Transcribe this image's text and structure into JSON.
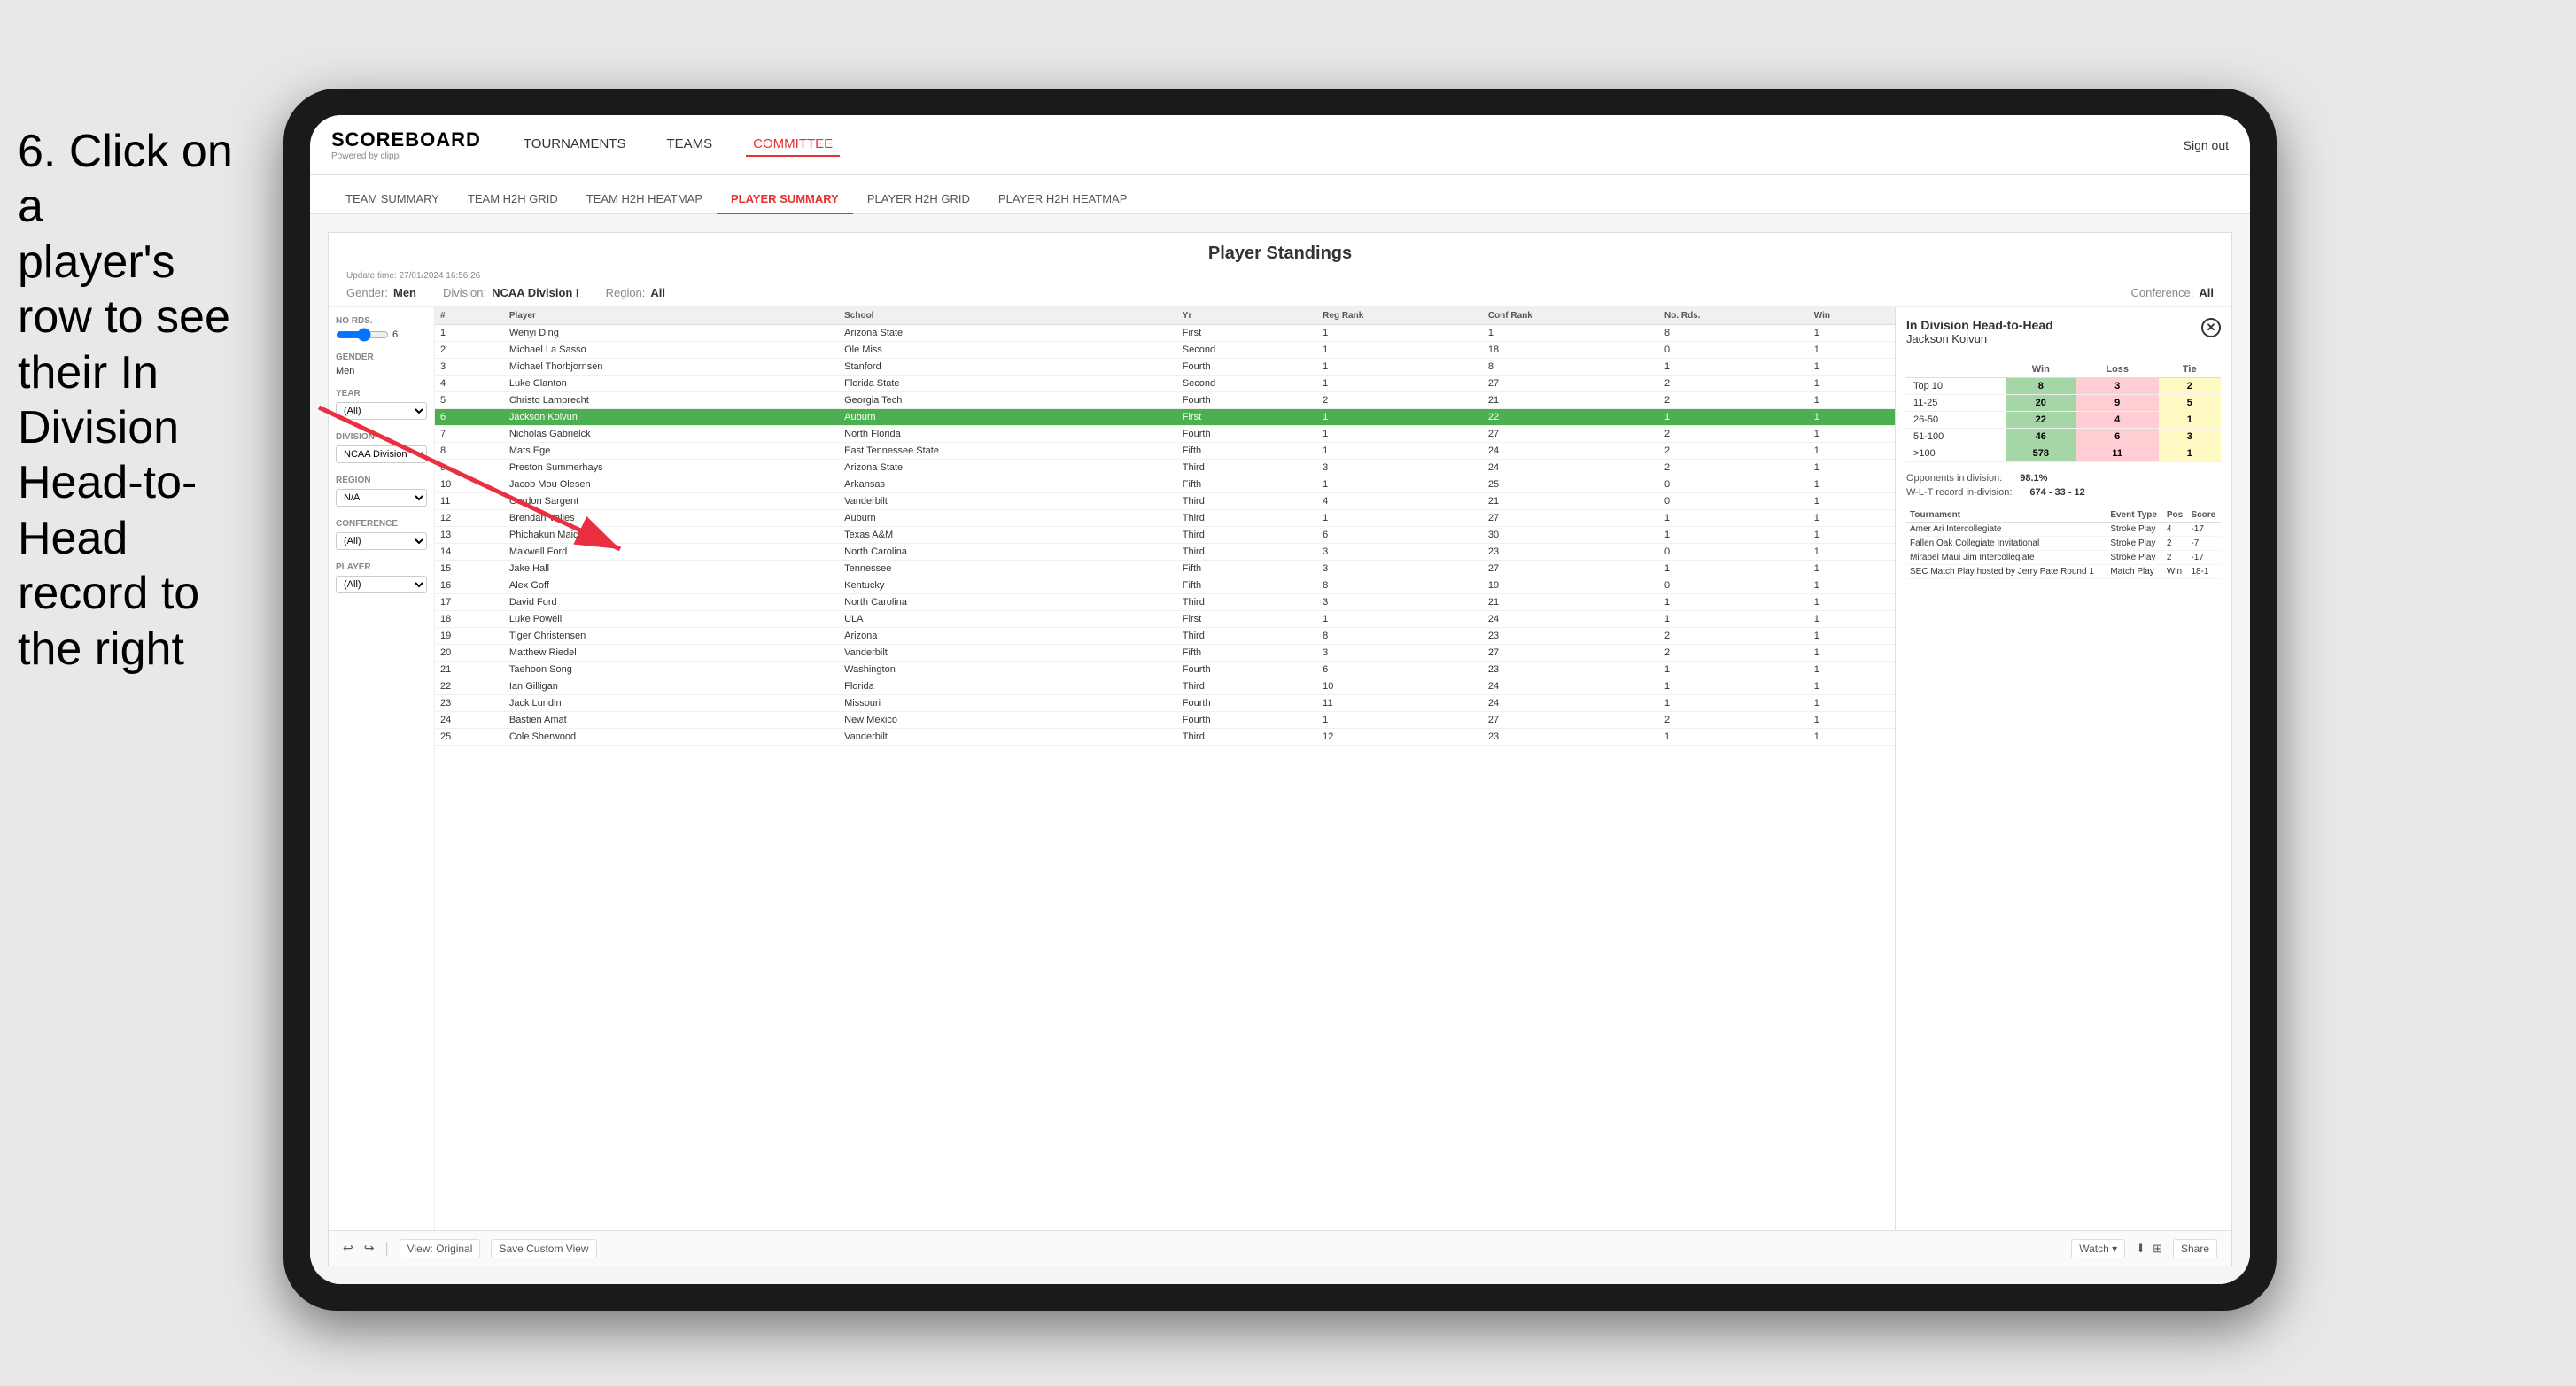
{
  "instruction": {
    "line1": "6. Click on a",
    "line2": "player's row to see",
    "line3": "their In Division",
    "line4": "Head-to-Head",
    "line5": "record to the right"
  },
  "nav": {
    "logo": "SCOREBOARD",
    "logo_sub": "Powered by clippi",
    "items": [
      "TOURNAMENTS",
      "TEAMS",
      "COMMITTEE"
    ],
    "sign_out": "Sign out"
  },
  "sub_nav": {
    "items": [
      "TEAM SUMMARY",
      "TEAM H2H GRID",
      "TEAM H2H HEATMAP",
      "PLAYER SUMMARY",
      "PLAYER H2H GRID",
      "PLAYER H2H HEATMAP"
    ]
  },
  "panel": {
    "title": "Player Standings",
    "update_time": "Update time:",
    "update_datetime": "27/01/2024 16:56:26",
    "filters": {
      "gender_label": "Gender:",
      "gender_value": "Men",
      "division_label": "Division:",
      "division_value": "NCAA Division I",
      "region_label": "Region:",
      "region_value": "All",
      "conference_label": "Conference:",
      "conference_value": "All"
    }
  },
  "sidebar": {
    "rounds_label": "No Rds.",
    "rounds_value": "6",
    "gender_label": "Gender",
    "gender_value": "Men",
    "year_label": "Year",
    "year_value": "(All)",
    "division_label": "Division",
    "division_value": "NCAA Division I",
    "region_label": "Region",
    "region_value": "N/A",
    "conference_label": "Conference",
    "conference_value": "(All)",
    "player_label": "Player",
    "player_value": "(All)"
  },
  "players": [
    {
      "rank": 1,
      "num": "1",
      "name": "Wenyi Ding",
      "school": "Arizona State",
      "yr": "First",
      "reg_rank": 1,
      "conf_rank": 1,
      "no_rds": 8,
      "win": 1
    },
    {
      "rank": 2,
      "num": "2",
      "name": "Michael La Sasso",
      "school": "Ole Miss",
      "yr": "Second",
      "reg_rank": 1,
      "conf_rank": 18,
      "no_rds": 0,
      "win": 1
    },
    {
      "rank": 3,
      "num": "3",
      "name": "Michael Thorbjornsen",
      "school": "Stanford",
      "yr": "Fourth",
      "reg_rank": 1,
      "conf_rank": 8,
      "no_rds": 1,
      "win": 1
    },
    {
      "rank": 4,
      "num": "4",
      "name": "Luke Clanton",
      "school": "Florida State",
      "yr": "Second",
      "reg_rank": 1,
      "conf_rank": 27,
      "no_rds": 2,
      "win": 1
    },
    {
      "rank": 5,
      "num": "5",
      "name": "Christo Lamprecht",
      "school": "Georgia Tech",
      "yr": "Fourth",
      "reg_rank": 2,
      "conf_rank": 21,
      "no_rds": 2,
      "win": 1
    },
    {
      "rank": 6,
      "num": "6",
      "name": "Jackson Koivun",
      "school": "Auburn",
      "yr": "First",
      "reg_rank": 1,
      "conf_rank": 22,
      "no_rds": 1,
      "win": 1,
      "selected": true
    },
    {
      "rank": 7,
      "num": "7",
      "name": "Nicholas Gabrielck",
      "school": "North Florida",
      "yr": "Fourth",
      "reg_rank": 1,
      "conf_rank": 27,
      "no_rds": 2,
      "win": 1
    },
    {
      "rank": 8,
      "num": "8",
      "name": "Mats Ege",
      "school": "East Tennessee State",
      "yr": "Fifth",
      "reg_rank": 1,
      "conf_rank": 24,
      "no_rds": 2,
      "win": 1
    },
    {
      "rank": 9,
      "num": "9",
      "name": "Preston Summerhays",
      "school": "Arizona State",
      "yr": "Third",
      "reg_rank": 3,
      "conf_rank": 24,
      "no_rds": 2,
      "win": 1
    },
    {
      "rank": 10,
      "num": "10",
      "name": "Jacob Mou Olesen",
      "school": "Arkansas",
      "yr": "Fifth",
      "reg_rank": 1,
      "conf_rank": 25,
      "no_rds": 0,
      "win": 1
    },
    {
      "rank": 11,
      "num": "11",
      "name": "Gordon Sargent",
      "school": "Vanderbilt",
      "yr": "Third",
      "reg_rank": 4,
      "conf_rank": 21,
      "no_rds": 0,
      "win": 1
    },
    {
      "rank": 12,
      "num": "12",
      "name": "Brendan Valles",
      "school": "Auburn",
      "yr": "Third",
      "reg_rank": 1,
      "conf_rank": 27,
      "no_rds": 1,
      "win": 1
    },
    {
      "rank": 13,
      "num": "13",
      "name": "Phichakun Maichon",
      "school": "Texas A&M",
      "yr": "Third",
      "reg_rank": 6,
      "conf_rank": 30,
      "no_rds": 1,
      "win": 1
    },
    {
      "rank": 14,
      "num": "14",
      "name": "Maxwell Ford",
      "school": "North Carolina",
      "yr": "Third",
      "reg_rank": 3,
      "conf_rank": 23,
      "no_rds": 0,
      "win": 1
    },
    {
      "rank": 15,
      "num": "15",
      "name": "Jake Hall",
      "school": "Tennessee",
      "yr": "Fifth",
      "reg_rank": 3,
      "conf_rank": 27,
      "no_rds": 1,
      "win": 1
    },
    {
      "rank": 16,
      "num": "16",
      "name": "Alex Goff",
      "school": "Kentucky",
      "yr": "Fifth",
      "reg_rank": 8,
      "conf_rank": 19,
      "no_rds": 0,
      "win": 1
    },
    {
      "rank": 17,
      "num": "17",
      "name": "David Ford",
      "school": "North Carolina",
      "yr": "Third",
      "reg_rank": 3,
      "conf_rank": 21,
      "no_rds": 1,
      "win": 1
    },
    {
      "rank": 18,
      "num": "18",
      "name": "Luke Powell",
      "school": "ULA",
      "yr": "First",
      "reg_rank": 1,
      "conf_rank": 24,
      "no_rds": 1,
      "win": 1
    },
    {
      "rank": 19,
      "num": "19",
      "name": "Tiger Christensen",
      "school": "Arizona",
      "yr": "Third",
      "reg_rank": 8,
      "conf_rank": 23,
      "no_rds": 2,
      "win": 1
    },
    {
      "rank": 20,
      "num": "20",
      "name": "Matthew Riedel",
      "school": "Vanderbilt",
      "yr": "Fifth",
      "reg_rank": 3,
      "conf_rank": 27,
      "no_rds": 2,
      "win": 1
    },
    {
      "rank": 21,
      "num": "21",
      "name": "Taehoon Song",
      "school": "Washington",
      "yr": "Fourth",
      "reg_rank": 6,
      "conf_rank": 23,
      "no_rds": 1,
      "win": 1
    },
    {
      "rank": 22,
      "num": "22",
      "name": "Ian Gilligan",
      "school": "Florida",
      "yr": "Third",
      "reg_rank": 10,
      "conf_rank": 24,
      "no_rds": 1,
      "win": 1
    },
    {
      "rank": 23,
      "num": "23",
      "name": "Jack Lundin",
      "school": "Missouri",
      "yr": "Fourth",
      "reg_rank": 11,
      "conf_rank": 24,
      "no_rds": 1,
      "win": 1
    },
    {
      "rank": 24,
      "num": "24",
      "name": "Bastien Amat",
      "school": "New Mexico",
      "yr": "Fourth",
      "reg_rank": 1,
      "conf_rank": 27,
      "no_rds": 2,
      "win": 1
    },
    {
      "rank": 25,
      "num": "25",
      "name": "Cole Sherwood",
      "school": "Vanderbilt",
      "yr": "Third",
      "reg_rank": 12,
      "conf_rank": 23,
      "no_rds": 1,
      "win": 1
    }
  ],
  "h2h": {
    "title": "In Division Head-to-Head",
    "player_name": "Jackson Koivun",
    "columns": [
      "Win",
      "Loss",
      "Tie"
    ],
    "rows": [
      {
        "range": "Top 10",
        "win": 8,
        "loss": 3,
        "tie": 2
      },
      {
        "range": "11-25",
        "win": 20,
        "loss": 9,
        "tie": 5
      },
      {
        "range": "26-50",
        "win": 22,
        "loss": 4,
        "tie": 1
      },
      {
        "range": "51-100",
        "win": 46,
        "loss": 6,
        "tie": 3
      },
      {
        "range": ">100",
        "win": 578,
        "loss": 11,
        "tie": 1
      }
    ],
    "opponents_label": "Opponents in division:",
    "opponents_value": "98.1%",
    "record_label": "W-L-T record in-division:",
    "record_value": "674 - 33 - 12",
    "tournaments": [
      {
        "name": "Amer Ari Intercollegiate",
        "event_type": "Stroke Play",
        "pos": 4,
        "score": "-17"
      },
      {
        "name": "Fallen Oak Collegiate Invitational",
        "event_type": "Stroke Play",
        "pos": 2,
        "score": "-7"
      },
      {
        "name": "Mirabel Maui Jim Intercollegiate",
        "event_type": "Stroke Play",
        "pos": 2,
        "score": "-17"
      },
      {
        "name": "SEC Match Play hosted by Jerry Pate Round 1",
        "event_type": "Match Play",
        "pos": "Win",
        "score": "18-1"
      }
    ]
  },
  "toolbar": {
    "view_original": "View: Original",
    "save_custom": "Save Custom View",
    "watch": "Watch ▾",
    "share": "Share"
  }
}
